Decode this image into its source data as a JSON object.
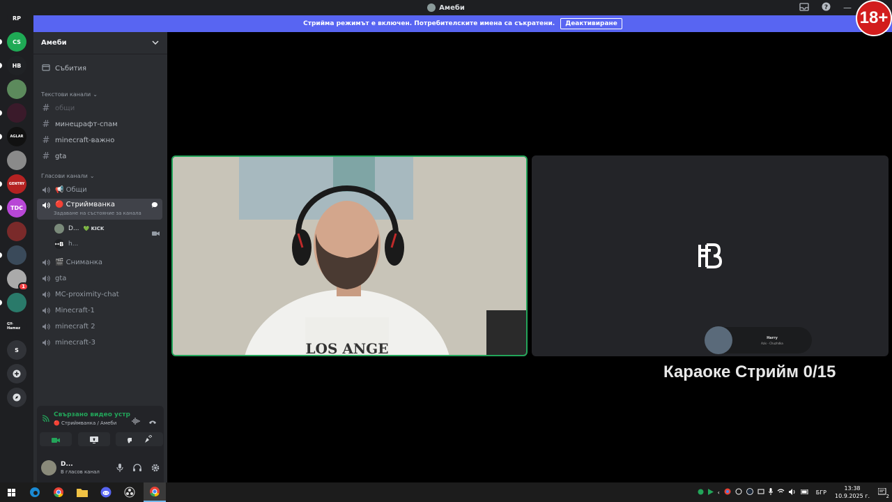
{
  "window": {
    "title": "Амеби",
    "age_badge": "18+"
  },
  "banner": {
    "text": "Стрийма режимът е включен. Потребителските имена са съкратени.",
    "button": "Деактивиране"
  },
  "rail": {
    "items": [
      {
        "name": "server-rp",
        "label": "RP",
        "color": "#1e1f22"
      },
      {
        "name": "server-cs",
        "label": "CS",
        "color": "#1faa55"
      },
      {
        "name": "server-hb",
        "label": "HB",
        "color": "#202225"
      },
      {
        "name": "server-tree",
        "label": "",
        "color": "#5c8a5c"
      },
      {
        "name": "server-wolf",
        "label": "",
        "color": "#3a1a2a"
      },
      {
        "name": "server-aglar",
        "label": "AGLAR",
        "color": "#111"
      },
      {
        "name": "server-statue",
        "label": "",
        "color": "#8a8a8a"
      },
      {
        "name": "server-gentry",
        "label": "GENTRY",
        "color": "#b52222"
      },
      {
        "name": "server-tdc",
        "label": "TDC",
        "color": "#b847d6"
      },
      {
        "name": "server-round",
        "label": "",
        "color": "#7a2a2a"
      },
      {
        "name": "server-face",
        "label": "",
        "color": "#3a4a5a"
      },
      {
        "name": "server-char",
        "label": "",
        "color": "#aaa"
      },
      {
        "name": "server-alien",
        "label": "",
        "color": "#2a7a6a"
      },
      {
        "name": "server-gameroom",
        "label": "GY-Hamez",
        "color": "#1e1f22"
      },
      {
        "name": "server-s",
        "label": "S",
        "color": "#313338"
      }
    ],
    "badge_count": "1"
  },
  "sidebar": {
    "server_name": "Амеби",
    "events": "Събития",
    "text_category": "Текстови канали",
    "text_channels": [
      "общи",
      "минецрафт-спам",
      "minecraft-важно",
      "gta"
    ],
    "voice_category": "Гласови канали",
    "voice_channels": {
      "c1": "📢 Общи",
      "c2": "🔴 Стриймванка",
      "c2_status": "Задаване на състояние за канала",
      "c3": "🎬 Сниманка",
      "c4": "gta",
      "c5": "MC-proximity-chat",
      "c6": "Minecraft-1",
      "c7": "minecraft 2",
      "c8": "minecraft-3"
    },
    "voice_users": [
      {
        "name": "D...",
        "tag": "💚 KICK"
      },
      {
        "name": "h...",
        "tag": ""
      }
    ]
  },
  "voice_panel": {
    "status": "Свързано видео устройство",
    "location": "🔴 Стриймванка / Амеби"
  },
  "user_panel": {
    "name": "D...",
    "status": "В гласов канал"
  },
  "stream": {
    "player_title": "Harry",
    "player_subtitle": "Azis - Chuzhdka",
    "overlay_text": "Караоке Стрийм 0/15"
  },
  "taskbar": {
    "language": "БГР",
    "time": "13:38",
    "date": "10.9.2025 г.",
    "notifications": "2"
  }
}
